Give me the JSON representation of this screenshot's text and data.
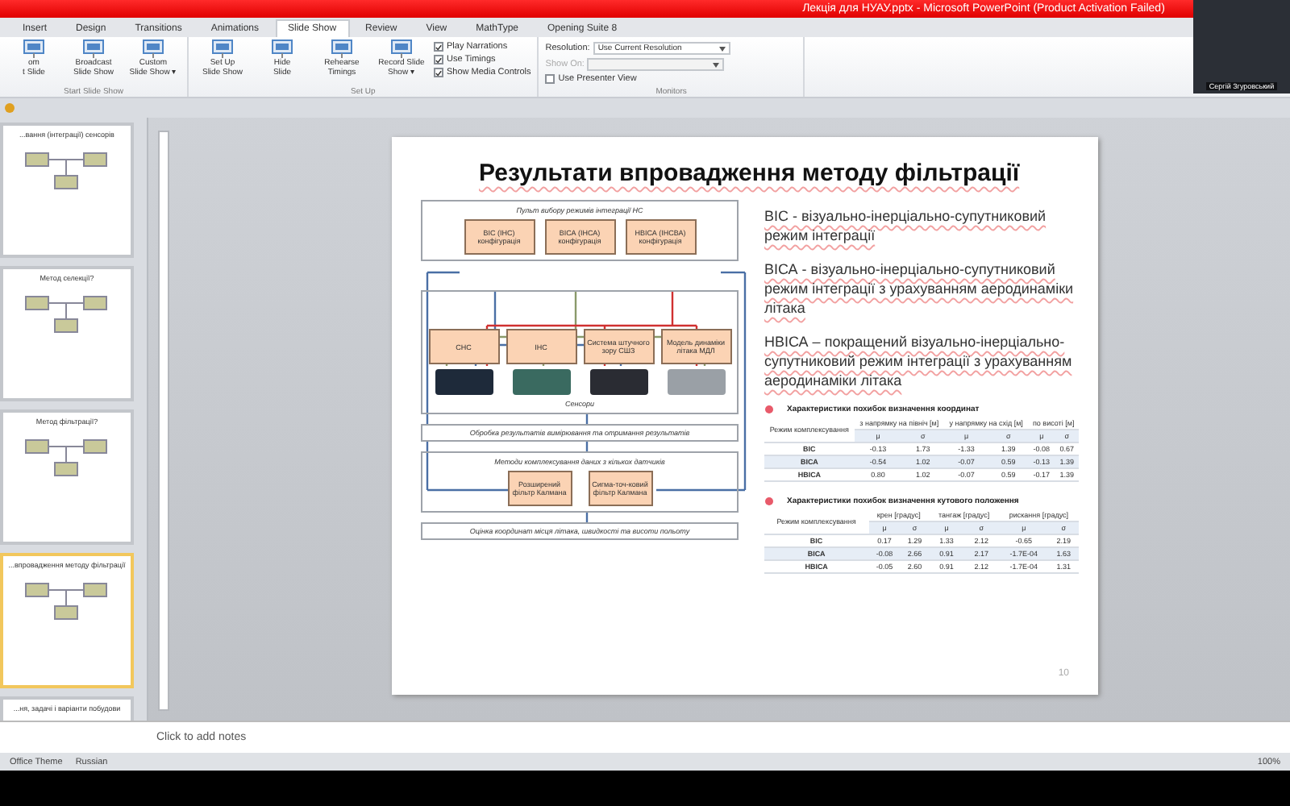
{
  "window": {
    "title": "Лекція для НУАУ.pptx - Microsoft PowerPoint (Product Activation Failed)"
  },
  "webcam": {
    "name": "Сергій Згуровський"
  },
  "tabs": [
    {
      "label": "Insert",
      "selected": false
    },
    {
      "label": "Design",
      "selected": false
    },
    {
      "label": "Transitions",
      "selected": false
    },
    {
      "label": "Animations",
      "selected": false
    },
    {
      "label": "Slide Show",
      "selected": true
    },
    {
      "label": "Review",
      "selected": false
    },
    {
      "label": "View",
      "selected": false
    },
    {
      "label": "MathType",
      "selected": false
    },
    {
      "label": "Opening Suite 8",
      "selected": false
    }
  ],
  "ribbon": {
    "start_group": {
      "label": "Start Slide Show",
      "buttons": [
        {
          "lines": [
            "om",
            "t Slide"
          ]
        },
        {
          "lines": [
            "Broadcast",
            "Slide Show"
          ]
        },
        {
          "lines": [
            "Custom",
            "Slide Show ▾"
          ]
        }
      ]
    },
    "setup_group": {
      "label": "Set Up",
      "buttons": [
        {
          "lines": [
            "Set Up",
            "Slide Show"
          ]
        },
        {
          "lines": [
            "Hide",
            "Slide"
          ]
        },
        {
          "lines": [
            "Rehearse",
            "Timings"
          ]
        },
        {
          "lines": [
            "Record Slide",
            "Show ▾"
          ]
        }
      ],
      "checks": [
        {
          "label": "Play Narrations",
          "checked": true
        },
        {
          "label": "Use Timings",
          "checked": true
        },
        {
          "label": "Show Media Controls",
          "checked": true
        }
      ]
    },
    "monitors_group": {
      "label": "Monitors",
      "resolution": {
        "label": "Resolution:",
        "value": "Use Current Resolution"
      },
      "show_on": {
        "label": "Show On:",
        "disabled": true
      },
      "presenter_view": {
        "label": "Use Presenter View",
        "checked": false
      }
    }
  },
  "thumbnails": [
    {
      "title": "...вання (інтеграції) сенсорів",
      "selected": false
    },
    {
      "title": "Метод селекції?",
      "selected": false
    },
    {
      "title": "Метод фільтрації?",
      "selected": false
    },
    {
      "title": "...впровадження методу фільтрації",
      "selected": true
    },
    {
      "title": "...ня, задачі і варіанти побудови",
      "selected": false
    }
  ],
  "slide": {
    "title": "Результати  впровадження  методу фільтрації",
    "diagram": {
      "mode_panel": {
        "title": "Пульт вибору режимів інтеграції НС",
        "configs": [
          "ВІС (ІНС) конфігурація",
          "ВІСА (ІНСА) конфігурація",
          "НВІСА (ІНСВА) конфігурація"
        ]
      },
      "sensors_panel": {
        "label": "Сенсори",
        "sensors": [
          "СНС",
          "ІНС",
          "Система штучного зору СШЗ",
          "Модель динаміки літака МДЛ"
        ]
      },
      "processing": "Обробка результатів вимірювання та отримання результатів",
      "fusion_panel": {
        "title": "Методи комплексування даних з кількох датчиків",
        "filters": [
          "Розширений фільтр Калмана",
          "Сигма-точ-ковий фільтр Калмана"
        ]
      },
      "output": "Оцінка координат місця літака, швидкості та висоти польоту"
    },
    "definitions": [
      "ВІС - візуально-інерціально-супутниковий режим інтеграції",
      "ВІСА - візуально-інерціально-супутниковий режим інтеграції з урахуванням аеродинаміки літака",
      "НВІСА – покращений візуально-інерціально-супутниковий режим інтеграції з урахуванням аеродинаміки літака"
    ],
    "tables": [
      {
        "caption": "Характеристики похибок визначення координат",
        "corner": "Режим комплексування",
        "groups": [
          "з напрямку на північ [м]",
          "у напрямку на схід [м]",
          "по висоті [м]"
        ],
        "sub": [
          "μ",
          "σ",
          "μ",
          "σ",
          "μ",
          "σ"
        ],
        "rows": [
          [
            "ВІС",
            "-0.13",
            "1.73",
            "-1.33",
            "1.39",
            "-0.08",
            "0.67"
          ],
          [
            "ВІСА",
            "-0.54",
            "1.02",
            "-0.07",
            "0.59",
            "-0.13",
            "1.39"
          ],
          [
            "НВІСА",
            "0.80",
            "1.02",
            "-0.07",
            "0.59",
            "-0.17",
            "1.39"
          ]
        ]
      },
      {
        "caption": "Характеристики похибок визначення кутового положення",
        "corner": "Режим комплексування",
        "groups": [
          "крен [градус]",
          "тангаж [градус]",
          "рискання [градус]"
        ],
        "sub": [
          "μ",
          "σ",
          "μ",
          "σ",
          "μ",
          "σ"
        ],
        "rows": [
          [
            "ВІС",
            "0.17",
            "1.29",
            "1.33",
            "2.12",
            "-0.65",
            "2.19"
          ],
          [
            "ВІСА",
            "-0.08",
            "2.66",
            "0.91",
            "2.17",
            "-1.7Е-04",
            "1.63"
          ],
          [
            "НВІСА",
            "-0.05",
            "2.60",
            "0.91",
            "2.12",
            "-1.7Е-04",
            "1.31"
          ]
        ]
      }
    ],
    "page_number": "10"
  },
  "notes": {
    "placeholder": "Click to add notes"
  },
  "status_bar": {
    "theme": "Office Theme",
    "language": "Russian",
    "zoom": "100%"
  }
}
